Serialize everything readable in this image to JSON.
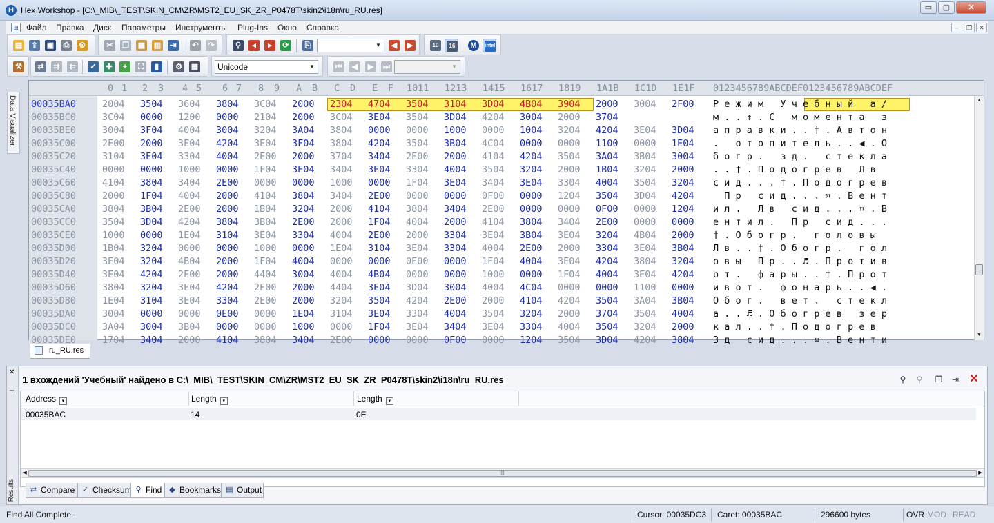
{
  "window": {
    "title": "Hex Workshop - [C:\\_MIB\\_TEST\\SKIN_CM\\ZR\\MST2_EU_SK_ZR_P0478T\\skin2\\i18n\\ru_RU.res]",
    "min": "▭",
    "max": "▢",
    "close": "✕"
  },
  "menu": {
    "items": [
      "Файл",
      "Правка",
      "Диск",
      "Параметры",
      "Инструменты",
      "Plug-Ins",
      "Окно",
      "Справка"
    ],
    "mdi": [
      "–",
      "❐",
      "✕"
    ]
  },
  "toolbar": {
    "encoding": "Unicode",
    "search_value": "",
    "nav_value": ""
  },
  "hex": {
    "ruler_offset_space": "",
    "ruler_hex": [
      "0",
      "1",
      "2",
      "3",
      "4",
      "5",
      "6",
      "7",
      "8",
      "9",
      "A",
      "B",
      "C",
      "D",
      "E",
      "F",
      "1011",
      "1213",
      "1415",
      "1617",
      "1819",
      "1A1B",
      "1C1D",
      "1E1F"
    ],
    "ruler_ascii": "0123456789ABCDEF0123456789ABCDEF",
    "found_ascii": "Учебный",
    "rows": [
      {
        "off": "00035BA0",
        "hex": [
          "2004",
          "3504",
          "3604",
          "3804",
          "3C04",
          "2000",
          "2304",
          "4704",
          "3504",
          "3104",
          "3D04",
          "4B04",
          "3904",
          "2000",
          "3004",
          "2F00"
        ],
        "ascii": "Р е ж и м   У ч е б н ы й   а /"
      },
      {
        "off": "00035BC0",
        "hex": [
          "3C04",
          "0000",
          "1200",
          "0000",
          "2104",
          "2000",
          "3C04",
          "3E04",
          "3504",
          "3D04",
          "4204",
          "3004",
          "2000",
          "3704",
          "",
          ""
        ],
        "ascii": "м . . ↕ . С   м о м е н т а   з"
      },
      {
        "off": "00035BE0",
        "hex": [
          "3004",
          "3F04",
          "4004",
          "3004",
          "3204",
          "3A04",
          "3804",
          "0000",
          "0000",
          "1000",
          "0000",
          "1004",
          "3204",
          "4204",
          "3E04",
          "3D04"
        ],
        "ascii": "а п р а в к и . . † . А в т о н"
      },
      {
        "off": "00035C00",
        "hex": [
          "2E00",
          "2000",
          "3E04",
          "4204",
          "3E04",
          "3F04",
          "3804",
          "4204",
          "3504",
          "3B04",
          "4C04",
          "0000",
          "0000",
          "1100",
          "0000",
          "1E04"
        ],
        "ascii": ".   о т о п и т е л ь . . ◀ . О"
      },
      {
        "off": "00035C20",
        "hex": [
          "3104",
          "3E04",
          "3304",
          "4004",
          "2E00",
          "2000",
          "3704",
          "3404",
          "2E00",
          "2000",
          "4104",
          "4204",
          "3504",
          "3A04",
          "3B04",
          "3004"
        ],
        "ascii": "б о г р .   з д .   с т е к л а"
      },
      {
        "off": "00035C40",
        "hex": [
          "0000",
          "0000",
          "1000",
          "0000",
          "1F04",
          "3E04",
          "3404",
          "3E04",
          "3304",
          "4004",
          "3504",
          "3204",
          "2000",
          "1B04",
          "3204",
          "2000"
        ],
        "ascii": ". . † . П о д о г р е в   Л в  "
      },
      {
        "off": "00035C60",
        "hex": [
          "4104",
          "3804",
          "3404",
          "2E00",
          "0000",
          "0000",
          "1000",
          "0000",
          "1F04",
          "3E04",
          "3404",
          "3E04",
          "3304",
          "4004",
          "3504",
          "3204"
        ],
        "ascii": "с и д . . . † . П о д о г р е в"
      },
      {
        "off": "00035C80",
        "hex": [
          "2000",
          "1F04",
          "4004",
          "2000",
          "4104",
          "3804",
          "3404",
          "2E00",
          "0000",
          "0000",
          "0F00",
          "0000",
          "1204",
          "3504",
          "3D04",
          "4204"
        ],
        "ascii": "  П р   с и д . . . ¤ . В е н т"
      },
      {
        "off": "00035CA0",
        "hex": [
          "3804",
          "3B04",
          "2E00",
          "2000",
          "1B04",
          "3204",
          "2000",
          "4104",
          "3804",
          "3404",
          "2E00",
          "0000",
          "0000",
          "0F00",
          "0000",
          "1204"
        ],
        "ascii": "и л .   Л в   с и д . . . ¤ . В"
      },
      {
        "off": "00035CC0",
        "hex": [
          "3504",
          "3D04",
          "4204",
          "3804",
          "3B04",
          "2E00",
          "2000",
          "1F04",
          "4004",
          "2000",
          "4104",
          "3804",
          "3404",
          "2E00",
          "0000",
          "0000"
        ],
        "ascii": "е н т и л .   П р   с и д . . ."
      },
      {
        "off": "00035CE0",
        "hex": [
          "1000",
          "0000",
          "1E04",
          "3104",
          "3E04",
          "3304",
          "4004",
          "2E00",
          "2000",
          "3304",
          "3E04",
          "3B04",
          "3E04",
          "3204",
          "4B04",
          "2000"
        ],
        "ascii": "† . О б о г р .   г о л о в ы  "
      },
      {
        "off": "00035D00",
        "hex": [
          "1B04",
          "3204",
          "0000",
          "0000",
          "1000",
          "0000",
          "1E04",
          "3104",
          "3E04",
          "3304",
          "4004",
          "2E00",
          "2000",
          "3304",
          "3E04",
          "3B04"
        ],
        "ascii": "Л в . . † . О б о г р .   г о л"
      },
      {
        "off": "00035D20",
        "hex": [
          "3E04",
          "3204",
          "4B04",
          "2000",
          "1F04",
          "4004",
          "0000",
          "0000",
          "0E00",
          "0000",
          "1F04",
          "4004",
          "3E04",
          "4204",
          "3804",
          "3204"
        ],
        "ascii": "о в ы   П р . . ♬ . П р о т и в"
      },
      {
        "off": "00035D40",
        "hex": [
          "3E04",
          "4204",
          "2E00",
          "2000",
          "4404",
          "3004",
          "4004",
          "4B04",
          "0000",
          "0000",
          "1000",
          "0000",
          "1F04",
          "4004",
          "3E04",
          "4204"
        ],
        "ascii": "о т .   ф а р ы . . † . П р о т"
      },
      {
        "off": "00035D60",
        "hex": [
          "3804",
          "3204",
          "3E04",
          "4204",
          "2E00",
          "2000",
          "4404",
          "3E04",
          "3D04",
          "3004",
          "4004",
          "4C04",
          "0000",
          "0000",
          "1100",
          "0000"
        ],
        "ascii": "и в о т .   ф о н а р ь . . ◀ ."
      },
      {
        "off": "00035D80",
        "hex": [
          "1E04",
          "3104",
          "3E04",
          "3304",
          "2E00",
          "2000",
          "3204",
          "3504",
          "4204",
          "2E00",
          "2000",
          "4104",
          "4204",
          "3504",
          "3A04",
          "3B04"
        ],
        "ascii": "О б о г .   в е т .   с т е к л"
      },
      {
        "off": "00035DA0",
        "hex": [
          "3004",
          "0000",
          "0000",
          "0E00",
          "0000",
          "1E04",
          "3104",
          "3E04",
          "3304",
          "4004",
          "3504",
          "3204",
          "2000",
          "3704",
          "3504",
          "4004"
        ],
        "ascii": "а . . ♬ . О б о г р е в   з е р"
      },
      {
        "off": "00035DC0",
        "hex": [
          "3A04",
          "3004",
          "3B04",
          "0000",
          "0000",
          "1000",
          "0000",
          "1F04",
          "3E04",
          "3404",
          "3E04",
          "3304",
          "4004",
          "3504",
          "3204",
          "2000"
        ],
        "ascii": "к а л . . † . П о д о г р е в  "
      },
      {
        "off": "00035DE0",
        "hex": [
          "1704",
          "3404",
          "2000",
          "4104",
          "3804",
          "3404",
          "2E00",
          "0000",
          "0000",
          "0F00",
          "0000",
          "1204",
          "3504",
          "3D04",
          "4204",
          "3804"
        ],
        "ascii": "З д   с и д . . . ¤ . В е н т и"
      }
    ]
  },
  "doc_tab": {
    "label": "ru_RU.res"
  },
  "results": {
    "side_label": "Results",
    "find_summary": "1 вхождений 'Учебный' найдено в C:\\_MIB\\_TEST\\SKIN_CM\\ZR\\MST2_EU_SK_ZR_P0478T\\skin2\\i18n\\ru_RU.res",
    "columns": [
      "Address",
      "Length",
      "Length"
    ],
    "row": [
      "00035BAC",
      "14",
      "0E"
    ],
    "tabs": [
      "Compare",
      "Checksum",
      "Find",
      "Bookmarks",
      "Output"
    ],
    "active_tab": "Find"
  },
  "status": {
    "message": "Find All Complete.",
    "cursor": "Cursor: 00035DC3",
    "caret": "Caret: 00035BAC",
    "size": "296600 bytes",
    "ovr": "OVR",
    "mod": "MOD",
    "read": "READ"
  },
  "side_panel": {
    "label": "Data Visualizer"
  }
}
